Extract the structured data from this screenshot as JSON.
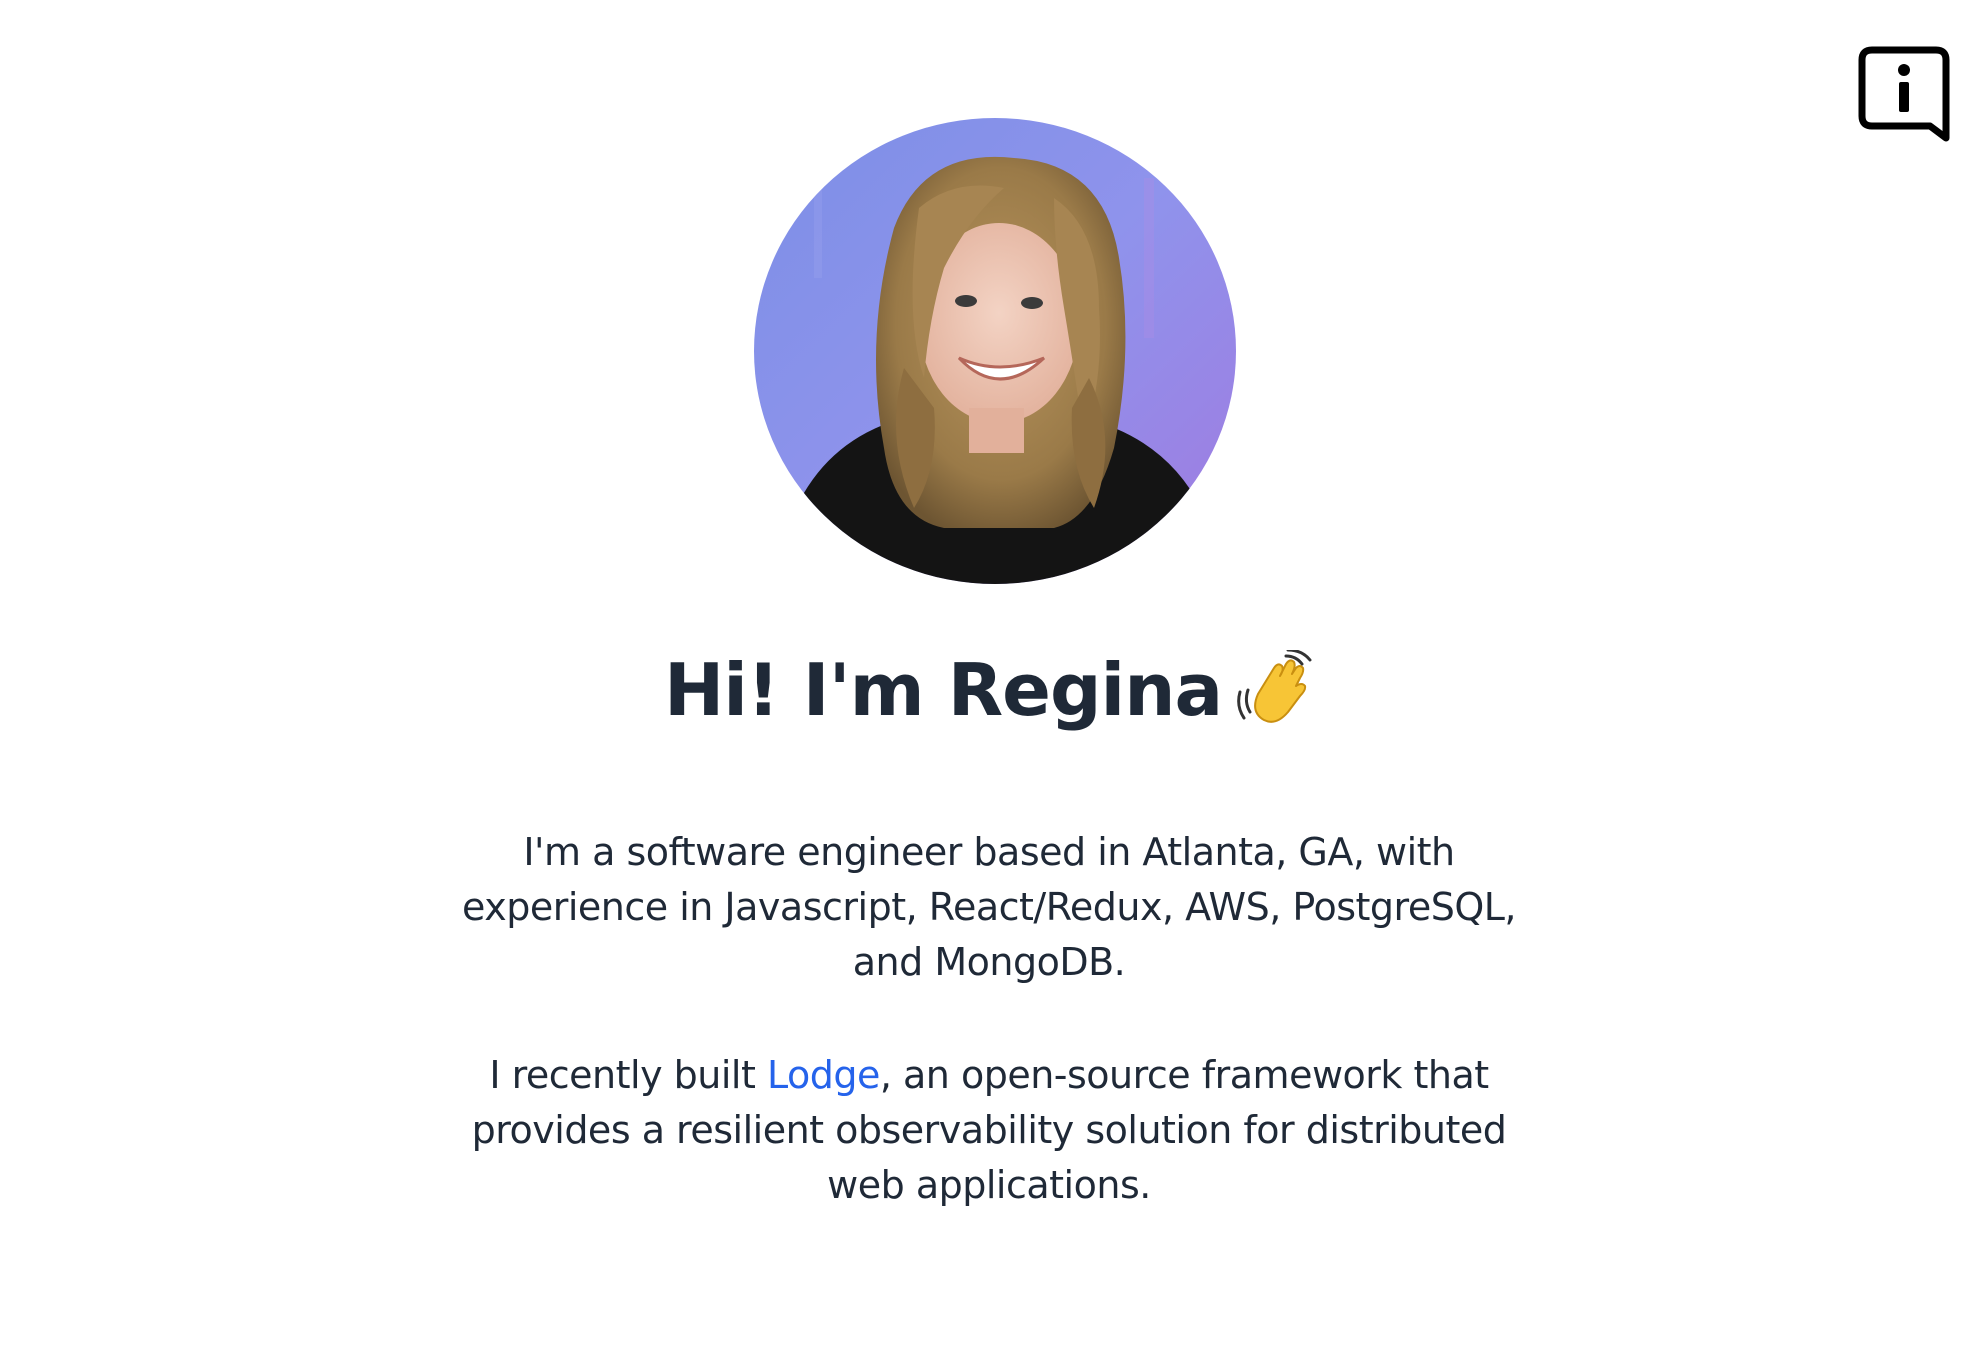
{
  "header": {
    "info_icon": "info-chat-icon"
  },
  "profile": {
    "avatar_alt": "Regina profile photo",
    "greeting": "Hi! I'm Regina",
    "greeting_emoji_icon": "waving-hand-icon"
  },
  "bio": {
    "paragraph1": {
      "line1": "I'm a software engineer based in Atlanta, GA, with",
      "line2": "experience in Javascript, React/Redux, AWS, PostgreSQL,",
      "line3": "and MongoDB."
    },
    "paragraph2": {
      "line1_prefix": "I recently built ",
      "link_text": "Lodge",
      "line1_suffix": ", an open-source framework that",
      "line2": "provides a resilient observability solution for distributed",
      "line3": "web applications."
    }
  },
  "colors": {
    "text": "#1f2937",
    "link": "#2563eb",
    "background": "#ffffff",
    "avatar_background": "#8b8fe8"
  }
}
